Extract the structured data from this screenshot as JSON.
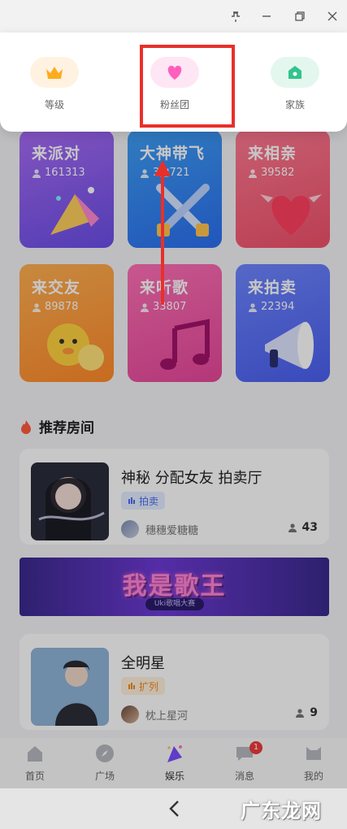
{
  "window": {
    "pin_icon": "pin-icon",
    "minimize_icon": "minimize-icon",
    "restore_icon": "restore-icon",
    "close_icon": "close-icon"
  },
  "popup": {
    "items": [
      {
        "label": "等级",
        "icon": "crown-icon"
      },
      {
        "label": "粉丝团",
        "icon": "heart-icon"
      },
      {
        "label": "家族",
        "icon": "home-icon"
      }
    ]
  },
  "categories": [
    {
      "title": "来派对",
      "count": "161313",
      "color": "#8a5cf0"
    },
    {
      "title": "大神带飞",
      "count": "3■721",
      "color": "#3a8cf3"
    },
    {
      "title": "来相亲",
      "count": "39582",
      "color": "#f4607c"
    },
    {
      "title": "来交友",
      "count": "89878",
      "color": "#ff9a3a"
    },
    {
      "title": "来听歌",
      "count": "33807",
      "color": "#f25aa8"
    },
    {
      "title": "来拍卖",
      "count": "22394",
      "color": "#5b70f8"
    }
  ],
  "section": {
    "title": "推荐房间"
  },
  "rooms": [
    {
      "title": "神秘  分配女友  拍卖厅",
      "tag": "拍卖",
      "owner": "穗穗爱糖糖",
      "online": "43"
    },
    {
      "title": "全明星",
      "tag": "扩列",
      "owner": "枕上星河",
      "online": "9"
    }
  ],
  "banner": {
    "title": "我是歌王",
    "subtitle": "Uki歌唱大赛"
  },
  "tabs": [
    {
      "label": "首页",
      "icon": "home-tab-icon"
    },
    {
      "label": "广场",
      "icon": "compass-icon"
    },
    {
      "label": "娱乐",
      "icon": "party-icon"
    },
    {
      "label": "消息",
      "icon": "message-icon",
      "badge": "1"
    },
    {
      "label": "我的",
      "icon": "profile-icon"
    }
  ],
  "watermark": "广东龙网",
  "accent": {
    "highlight": "#e8302b",
    "purple": "#8a5cf0"
  }
}
